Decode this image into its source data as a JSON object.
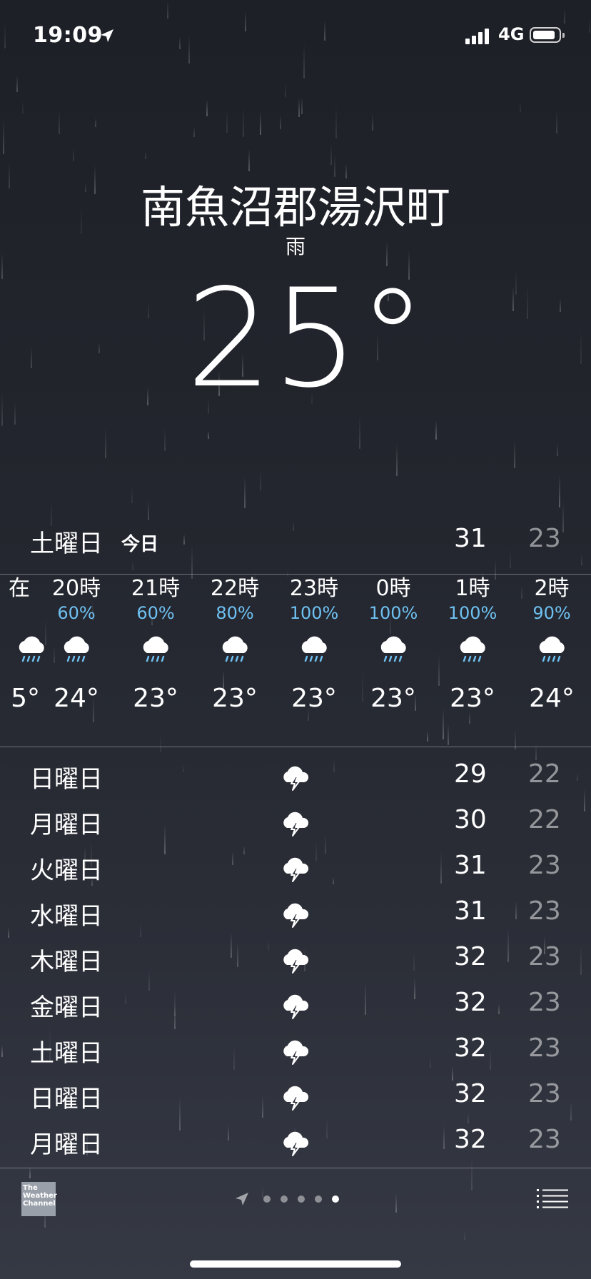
{
  "status_bar": {
    "time": "19:09",
    "network": "4G"
  },
  "weather": {
    "city": "南魚沼郡湯沢町",
    "condition": "雨",
    "temperature": "25°"
  },
  "today": {
    "day": "土曜日",
    "tag": "今日",
    "high": "31",
    "low": "23"
  },
  "hourly": [
    {
      "label": "在",
      "pct": "",
      "temp": "5°",
      "icon": "rain-icon"
    },
    {
      "label": "20時",
      "pct": "60%",
      "temp": "24°",
      "icon": "rain-icon"
    },
    {
      "label": "21時",
      "pct": "60%",
      "temp": "23°",
      "icon": "rain-icon"
    },
    {
      "label": "22時",
      "pct": "80%",
      "temp": "23°",
      "icon": "rain-icon"
    },
    {
      "label": "23時",
      "pct": "100%",
      "temp": "23°",
      "icon": "rain-icon"
    },
    {
      "label": "0時",
      "pct": "100%",
      "temp": "23°",
      "icon": "rain-icon"
    },
    {
      "label": "1時",
      "pct": "100%",
      "temp": "23°",
      "icon": "rain-icon"
    },
    {
      "label": "2時",
      "pct": "90%",
      "temp": "24°",
      "icon": "rain-icon"
    }
  ],
  "daily": [
    {
      "day": "日曜日",
      "high": "29",
      "low": "22",
      "icon": "thunderstorm-icon"
    },
    {
      "day": "月曜日",
      "high": "30",
      "low": "22",
      "icon": "thunderstorm-icon"
    },
    {
      "day": "火曜日",
      "high": "31",
      "low": "23",
      "icon": "thunderstorm-icon"
    },
    {
      "day": "水曜日",
      "high": "31",
      "low": "23",
      "icon": "thunderstorm-icon"
    },
    {
      "day": "木曜日",
      "high": "32",
      "low": "23",
      "icon": "thunderstorm-icon"
    },
    {
      "day": "金曜日",
      "high": "32",
      "low": "23",
      "icon": "thunderstorm-icon"
    },
    {
      "day": "土曜日",
      "high": "32",
      "low": "23",
      "icon": "thunderstorm-icon"
    },
    {
      "day": "日曜日",
      "high": "32",
      "low": "23",
      "icon": "thunderstorm-icon"
    },
    {
      "day": "月曜日",
      "high": "32",
      "low": "23",
      "icon": "thunderstorm-icon"
    }
  ],
  "footer": {
    "logo_text": "The Weather Channel",
    "page_count": 5,
    "active_page": 4
  },
  "colors": {
    "precip": "#6ec1f2",
    "low_temp": "rgba(255,255,255,0.5)"
  }
}
